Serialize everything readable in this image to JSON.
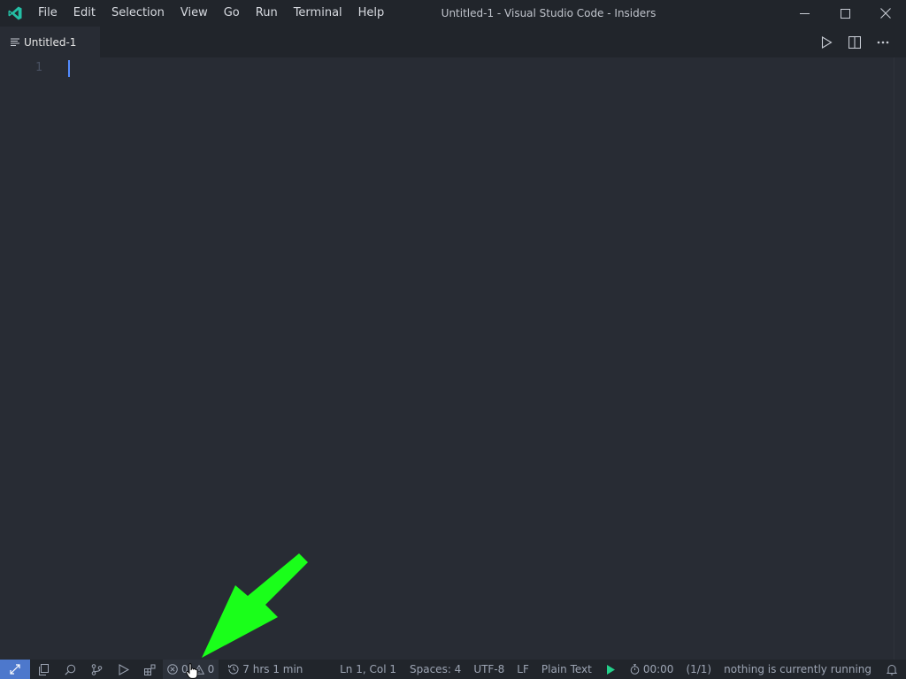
{
  "titlebar": {
    "menu": [
      "File",
      "Edit",
      "Selection",
      "View",
      "Go",
      "Run",
      "Terminal",
      "Help"
    ],
    "window_title": "Untitled-1 - Visual Studio Code - Insiders",
    "logo_icon": "vscode-insiders-logo-icon",
    "controls": [
      "minimize-icon",
      "maximize-icon",
      "close-icon"
    ]
  },
  "tabs": [
    {
      "label": "Untitled-1",
      "icon": "file-lines-icon",
      "active": true
    }
  ],
  "editor_actions": [
    "run-icon",
    "split-editor-icon",
    "more-actions-icon"
  ],
  "editor": {
    "line_numbers": [
      "1"
    ],
    "content": ""
  },
  "statusbar": {
    "remote_icon": "remote-icon",
    "activity_icons": [
      "explorer-icon",
      "search-icon",
      "source-control-icon",
      "run-debug-icon",
      "extensions-icon"
    ],
    "errors": "0",
    "warnings": "0",
    "time_tracker": "7 hrs 1 min",
    "position": "Ln 1, Col 1",
    "indentation": "Spaces: 4",
    "encoding": "UTF-8",
    "eol": "LF",
    "language": "Plain Text",
    "timer": "00:00",
    "counter": "(1/1)",
    "task_status": "nothing is currently running",
    "accent_color": "#4d78cc",
    "run_color": "#23d18b"
  },
  "annotation": {
    "arrow_color": "#1aff1a"
  }
}
